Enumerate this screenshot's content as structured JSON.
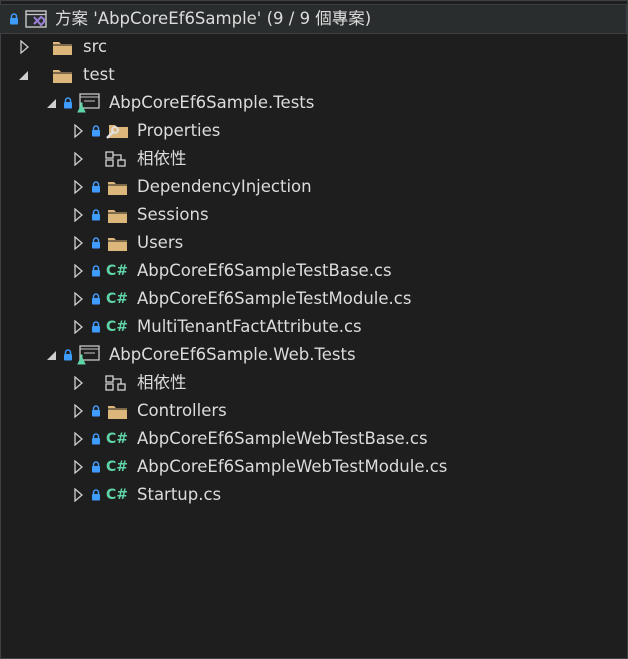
{
  "solution": {
    "label": "方案 'AbpCoreEf6Sample' (9 / 9 個專案)"
  },
  "tree": [
    {
      "label": "src",
      "icon": "folder-icon",
      "expand": "collapsed"
    },
    {
      "label": "test",
      "icon": "folder-icon",
      "expand": "expanded"
    },
    {
      "label": "AbpCoreEf6Sample.Tests",
      "icon": "test-project-icon",
      "expand": "expanded"
    },
    {
      "label": "Properties",
      "icon": "properties-folder-icon",
      "expand": "collapsed"
    },
    {
      "label": "相依性",
      "icon": "dependencies-icon",
      "expand": "collapsed"
    },
    {
      "label": "DependencyInjection",
      "icon": "folder-icon",
      "expand": "collapsed"
    },
    {
      "label": "Sessions",
      "icon": "folder-icon",
      "expand": "collapsed"
    },
    {
      "label": "Users",
      "icon": "folder-icon",
      "expand": "collapsed"
    },
    {
      "label": "AbpCoreEf6SampleTestBase.cs",
      "icon": "csharp-file-icon",
      "expand": "collapsed"
    },
    {
      "label": "AbpCoreEf6SampleTestModule.cs",
      "icon": "csharp-file-icon",
      "expand": "collapsed"
    },
    {
      "label": "MultiTenantFactAttribute.cs",
      "icon": "csharp-file-icon",
      "expand": "collapsed"
    },
    {
      "label": "AbpCoreEf6Sample.Web.Tests",
      "icon": "test-project-icon",
      "expand": "expanded"
    },
    {
      "label": "相依性",
      "icon": "dependencies-icon",
      "expand": "collapsed"
    },
    {
      "label": "Controllers",
      "icon": "folder-icon",
      "expand": "collapsed"
    },
    {
      "label": "AbpCoreEf6SampleWebTestBase.cs",
      "icon": "csharp-file-icon",
      "expand": "collapsed"
    },
    {
      "label": "AbpCoreEf6SampleWebTestModule.cs",
      "icon": "csharp-file-icon",
      "expand": "collapsed"
    },
    {
      "label": "Startup.cs",
      "icon": "csharp-file-icon",
      "expand": "collapsed"
    }
  ],
  "icon_text": {
    "csharp": "C#"
  },
  "colors": {
    "background": "#1e1e1e",
    "text": "#dcdcdc",
    "folder": "#dcb67a",
    "lock": "#3f9cff",
    "csharp": "#5fd4a6",
    "solution_icon": "#9b7fd8"
  }
}
